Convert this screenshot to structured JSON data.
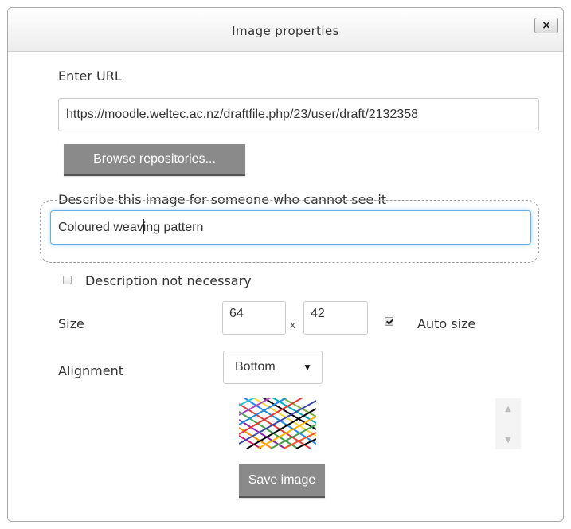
{
  "dialog": {
    "title": "Image properties",
    "close_label": "×"
  },
  "url": {
    "label": "Enter URL",
    "value": "https://moodle.weltec.ac.nz/draftfile.php/23/user/draft/2132358",
    "browse_label": "Browse repositories..."
  },
  "description": {
    "label": "Describe this image for someone who cannot see it",
    "value_before_caret": "Coloured weav",
    "value_after_caret": "ing pattern",
    "not_necessary_label": "Description not necessary",
    "not_necessary_checked": false
  },
  "size": {
    "label": "Size",
    "width": "64",
    "separator": "x",
    "height": "42",
    "auto_size_label": "Auto size",
    "auto_size_checked": true
  },
  "alignment": {
    "label": "Alignment",
    "selected": "Bottom",
    "arrow": "▼"
  },
  "preview": {
    "icon": "woven-pattern-thumbnail",
    "scroll_up": "▲",
    "scroll_down": "▼"
  },
  "save_label": "Save image",
  "colors": {
    "focus_border": "#66afe9",
    "button_grey": "#8a8a8a"
  }
}
